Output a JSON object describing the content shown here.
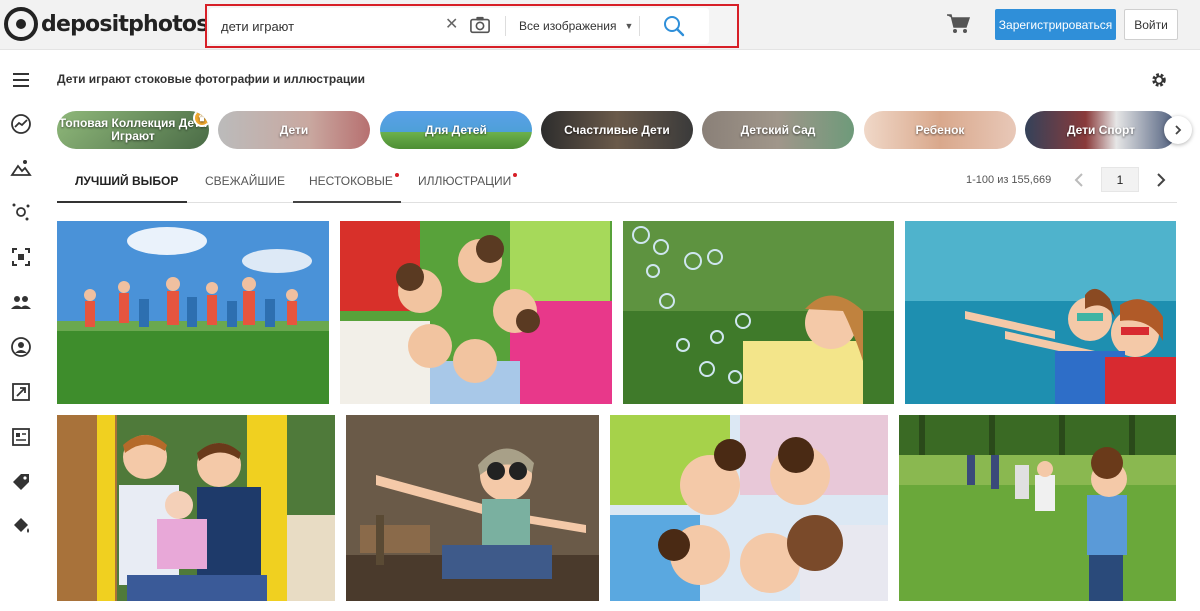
{
  "header": {
    "logo_text": "depositphotos",
    "logo_mark": "®",
    "search_value": "дети играют",
    "search_type": "Все изображения",
    "register_label": "Зарегистрироваться",
    "login_label": "Войти",
    "icons": [
      "clear-icon",
      "camera-icon",
      "chevron-down-icon",
      "search-icon",
      "cart-icon"
    ]
  },
  "sidebar": {
    "icons": [
      "menu-icon",
      "trending-icon",
      "photo-icon",
      "sparkle-icon",
      "focus-frame-icon",
      "people-icon",
      "user-circle-icon",
      "resize-icon",
      "article-icon",
      "tag-icon",
      "paint-bucket-icon"
    ]
  },
  "page": {
    "title": "Дети играют стоковые фотографии и иллюстрации"
  },
  "collections": [
    {
      "label": "Топовая Коллекция Дети Играют",
      "color": "#6a8e62"
    },
    {
      "label": "Дети",
      "color": "#a9a9a9"
    },
    {
      "label": "Для Детей",
      "color": "#4e86c9"
    },
    {
      "label": "Счастливые Дети",
      "color": "#4e4e4e"
    },
    {
      "label": "Детский Сад",
      "color": "#7b7470"
    },
    {
      "label": "Ребенок",
      "color": "#d9b29c"
    },
    {
      "label": "Дети Спорт",
      "color": "#44546c"
    }
  ],
  "tabs": [
    {
      "label": "ЛУЧШИЙ ВЫБОР",
      "active": true
    },
    {
      "label": "СВЕЖАЙШИЕ",
      "active": false
    },
    {
      "label": "НЕСТОКОВЫЕ",
      "active": false
    },
    {
      "label": "ИЛЛЮСТРАЦИИ",
      "active": false
    }
  ],
  "pagination": {
    "results": "1-100 из 155,669",
    "page": "1"
  },
  "colors": {
    "accent": "#2f8fd9",
    "search_border": "#d71f27"
  }
}
